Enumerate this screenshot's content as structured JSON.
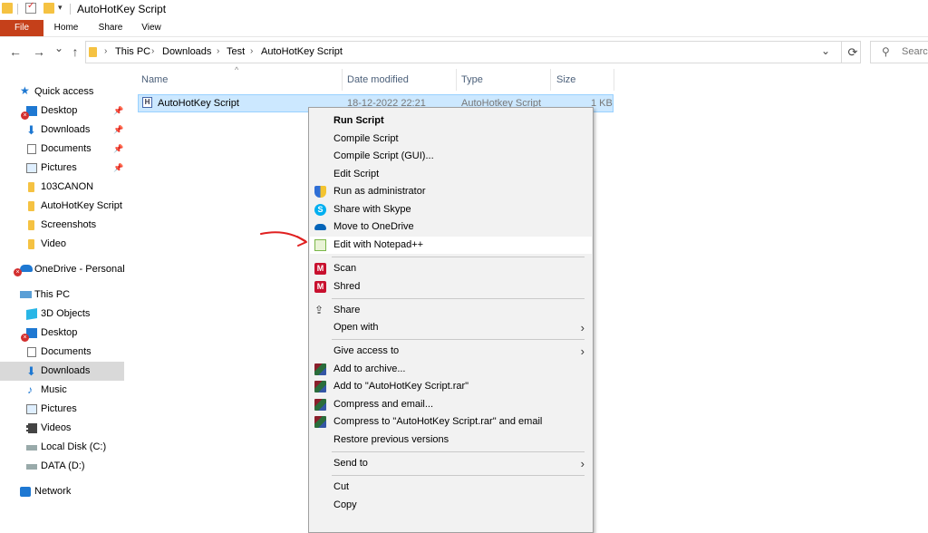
{
  "window": {
    "title": "AutoHotKey Script"
  },
  "ribbon": {
    "tabs": [
      "File",
      "Home",
      "Share",
      "View"
    ]
  },
  "nav_buttons": {
    "back": "←",
    "forward": "→",
    "recent": "⌄",
    "up": "↑"
  },
  "address": {
    "crumbs": [
      "This PC",
      "Downloads",
      "Test",
      "AutoHotKey Script"
    ],
    "separator": "›",
    "dropdown": "⌄",
    "refresh": "⟳"
  },
  "search": {
    "placeholder": "Search"
  },
  "sidebar": {
    "items": [
      {
        "label": "Quick access",
        "icon": "star-icon"
      },
      {
        "label": "Desktop",
        "icon": "desktop-icon",
        "pinned": "📌"
      },
      {
        "label": "Downloads",
        "icon": "download-icon",
        "pinned": "📌"
      },
      {
        "label": "Documents",
        "icon": "documents-icon",
        "pinned": "📌"
      },
      {
        "label": "Pictures",
        "icon": "pictures-icon",
        "pinned": "📌"
      },
      {
        "label": "103CANON",
        "icon": "folder-icon"
      },
      {
        "label": "AutoHotKey Script",
        "icon": "folder-icon"
      },
      {
        "label": "Screenshots",
        "icon": "folder-icon"
      },
      {
        "label": "Video",
        "icon": "folder-icon"
      },
      {
        "label": "OneDrive - Personal",
        "icon": "cloud-icon"
      },
      {
        "label": "This PC",
        "icon": "pc-icon"
      },
      {
        "label": "3D Objects",
        "icon": "cube-icon"
      },
      {
        "label": "Desktop",
        "icon": "desktop-icon"
      },
      {
        "label": "Documents",
        "icon": "documents-icon"
      },
      {
        "label": "Downloads",
        "icon": "download-icon"
      },
      {
        "label": "Music",
        "icon": "music-icon"
      },
      {
        "label": "Pictures",
        "icon": "pictures-icon"
      },
      {
        "label": "Videos",
        "icon": "video-icon"
      },
      {
        "label": "Local Disk (C:)",
        "icon": "drive-icon"
      },
      {
        "label": "DATA (D:)",
        "icon": "drive-icon"
      },
      {
        "label": "Network",
        "icon": "network-icon"
      }
    ],
    "selected": "Downloads"
  },
  "file_list": {
    "columns": [
      "Name",
      "Date modified",
      "Type",
      "Size"
    ],
    "rows": [
      {
        "name": "AutoHotKey Script",
        "date": "18-12-2022 22:21",
        "type": "AutoHotkey Script",
        "size": "1 KB"
      }
    ]
  },
  "context_menu": {
    "items": [
      {
        "label": "Run Script",
        "bold": true
      },
      {
        "label": "Compile Script"
      },
      {
        "label": "Compile Script (GUI)..."
      },
      {
        "label": "Edit Script"
      },
      {
        "label": "Run as administrator",
        "icon": "shield-icon"
      },
      {
        "label": "Share with Skype",
        "icon": "skype-icon"
      },
      {
        "label": "Move to OneDrive",
        "icon": "onedrive-icon"
      },
      {
        "label": "Edit with Notepad++",
        "icon": "notepad-plus-plus-icon"
      },
      {
        "label": "Scan",
        "icon": "mcafee-icon"
      },
      {
        "label": "Shred",
        "icon": "mcafee-icon"
      },
      {
        "label": "Share",
        "icon": "share-icon"
      },
      {
        "label": "Open with",
        "submenu": true
      },
      {
        "label": "Give access to",
        "submenu": true
      },
      {
        "label": "Add to archive...",
        "icon": "winrar-icon"
      },
      {
        "label": "Add to \"AutoHotKey Script.rar\"",
        "icon": "winrar-icon"
      },
      {
        "label": "Compress and email...",
        "icon": "winrar-icon"
      },
      {
        "label": "Compress to \"AutoHotKey Script.rar\" and email",
        "icon": "winrar-icon"
      },
      {
        "label": "Restore previous versions"
      },
      {
        "label": "Send to",
        "submenu": true
      },
      {
        "label": "Cut"
      },
      {
        "label": "Copy"
      }
    ],
    "submenu_arrow": "›"
  },
  "annotation": {
    "arrow_color": "#e02020",
    "points_to": "Edit with Notepad++"
  },
  "colors": {
    "file_tab": "#c5401a",
    "selection": "#cce8ff",
    "folder": "#f5c242"
  }
}
